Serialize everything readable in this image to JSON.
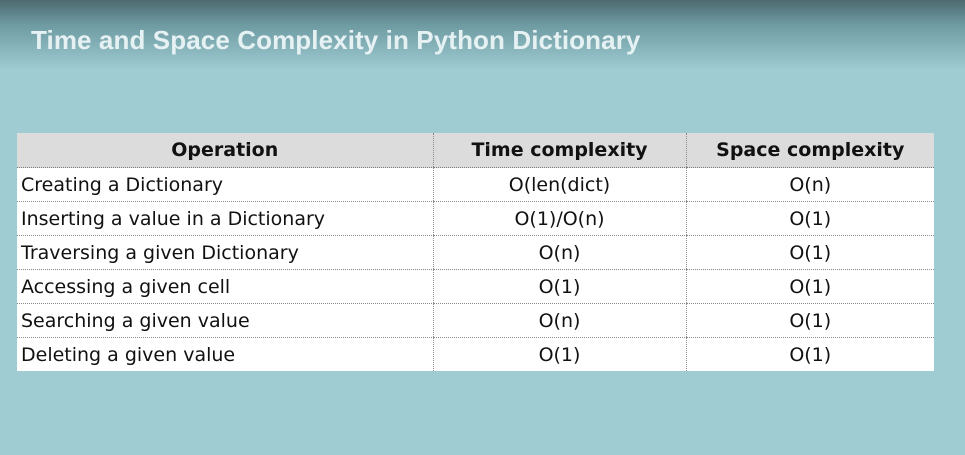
{
  "slide": {
    "title": "Time and Space Complexity in Python Dictionary"
  },
  "table": {
    "headers": [
      "Operation",
      "Time complexity",
      "Space complexity"
    ],
    "rows": [
      [
        "Creating a Dictionary",
        "O(len(dict)",
        "O(n)"
      ],
      [
        "Inserting a value in a Dictionary",
        "O(1)/O(n)",
        "O(1)"
      ],
      [
        "Traversing a given Dictionary",
        "O(n)",
        "O(1)"
      ],
      [
        "Accessing a given cell",
        "O(1)",
        "O(1)"
      ],
      [
        "Searching a given value",
        "O(n)",
        "O(1)"
      ],
      [
        "Deleting a given value",
        "O(1)",
        "O(1)"
      ]
    ]
  },
  "colors": {
    "background": "#9fccd3",
    "title": "#e6f1f3",
    "header_fill": "#dcdcdc",
    "table_fill": "#ffffff"
  }
}
